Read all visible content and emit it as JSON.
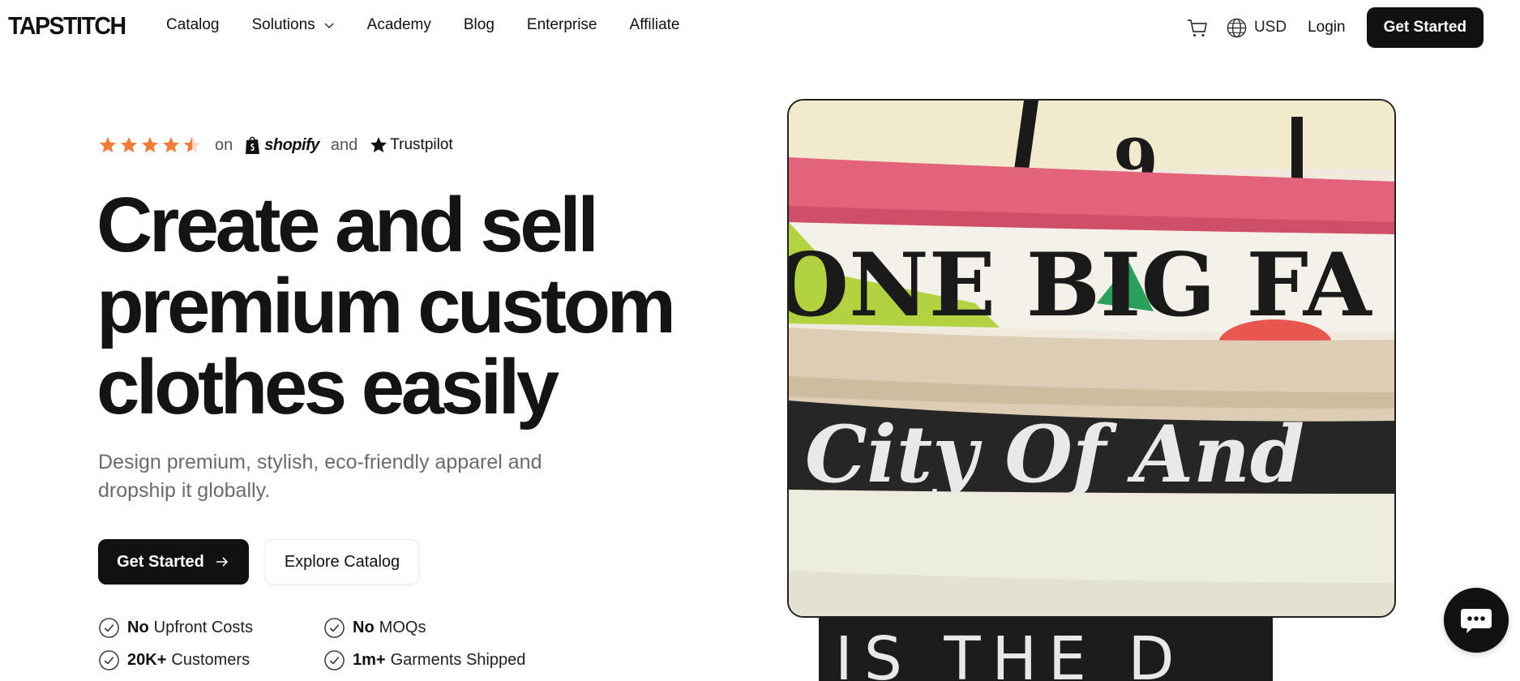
{
  "brand": {
    "logo": "TAPSTITCH"
  },
  "nav": {
    "items": [
      {
        "label": "Catalog"
      },
      {
        "label": "Solutions",
        "has_dropdown": true
      },
      {
        "label": "Academy"
      },
      {
        "label": "Blog"
      },
      {
        "label": "Enterprise"
      },
      {
        "label": "Affiliate"
      }
    ]
  },
  "header": {
    "cart_icon": "cart-icon",
    "currency_icon": "globe-icon",
    "currency": "USD",
    "login": "Login",
    "cta": "Get Started"
  },
  "rating": {
    "stars": 4.5,
    "on": "on",
    "shopify": "shopify",
    "and": "and",
    "trustpilot": "Trustpilot",
    "star_color": "#f07b3b"
  },
  "hero": {
    "headline_line1": "Create and sell",
    "headline_line2": "premium custom",
    "headline_line3": "clothes easily",
    "subtext": "Design premium, stylish, eco-friendly apparel and dropship it globally.",
    "primary_cta": "Get Started",
    "secondary_cta": "Explore Catalog"
  },
  "features": [
    {
      "bold": "No",
      "text": "Upfront Costs"
    },
    {
      "bold": "No",
      "text": "MOQs"
    },
    {
      "bold": "20K+",
      "text": "Customers"
    },
    {
      "bold": "1m+",
      "text": "Garments Shipped"
    }
  ],
  "image": {
    "shirt_texts": [
      "9",
      "ONE BIG FA",
      "City Of And",
      "IS THE D"
    ]
  },
  "chat": {
    "icon": "chat-icon"
  }
}
